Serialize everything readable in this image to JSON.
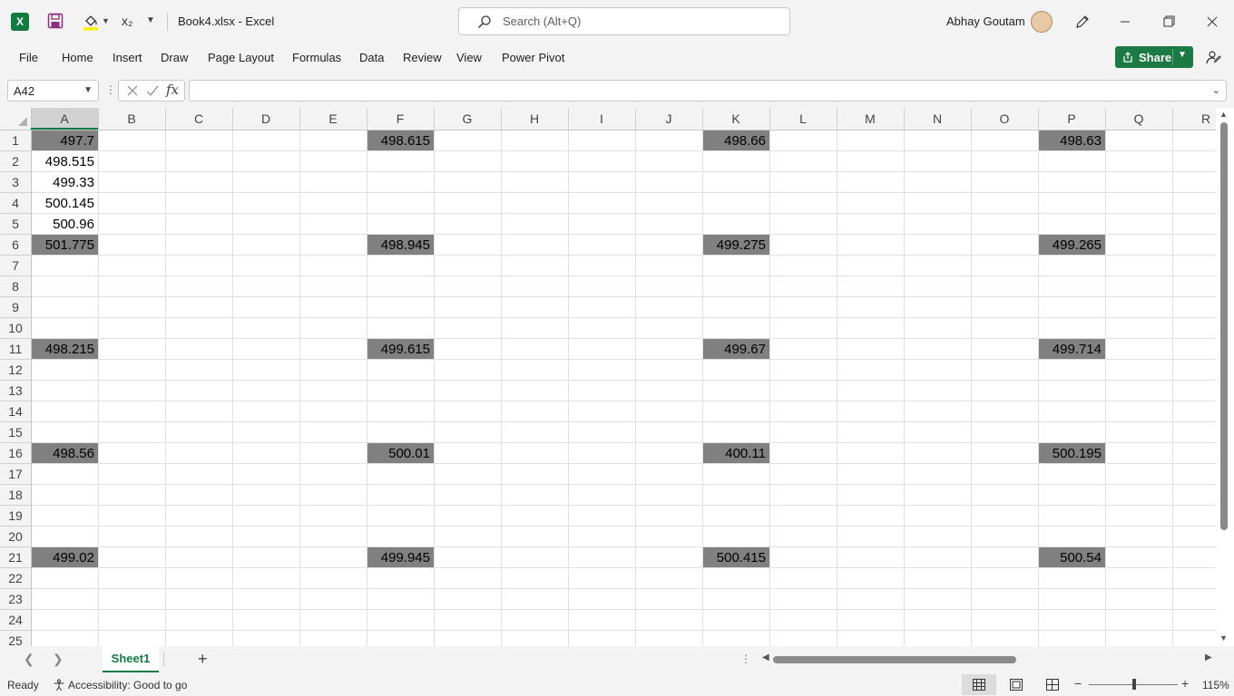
{
  "titlebar": {
    "doc_title": "Book4.xlsx  -  Excel",
    "search_placeholder": "Search (Alt+Q)",
    "user_name": "Abhay Goutam",
    "subscript_label": "x₂",
    "logo_letter": "X"
  },
  "ribbon": {
    "tabs": [
      "File",
      "Home",
      "Insert",
      "Draw",
      "Page Layout",
      "Formulas",
      "Data",
      "Review",
      "View",
      "Power Pivot"
    ],
    "share_label": "Share"
  },
  "formula_bar": {
    "name_box": "A42",
    "fx_label": "fx",
    "formula": ""
  },
  "grid": {
    "columns": [
      "A",
      "B",
      "C",
      "D",
      "E",
      "F",
      "G",
      "H",
      "I",
      "J",
      "K",
      "L",
      "M",
      "N",
      "O",
      "P",
      "Q",
      "R"
    ],
    "rows": [
      "1",
      "2",
      "3",
      "4",
      "5",
      "6",
      "7",
      "8",
      "9",
      "10",
      "11",
      "12",
      "13",
      "14",
      "15",
      "16",
      "17",
      "18",
      "19",
      "20",
      "21",
      "22",
      "23",
      "24",
      "25"
    ],
    "active_column": "A",
    "highlight_fill": "#808080",
    "cells": [
      {
        "col": "A",
        "row": 1,
        "value": "497.7",
        "highlight": true
      },
      {
        "col": "A",
        "row": 2,
        "value": "498.515",
        "highlight": false
      },
      {
        "col": "A",
        "row": 3,
        "value": "499.33",
        "highlight": false
      },
      {
        "col": "A",
        "row": 4,
        "value": "500.145",
        "highlight": false
      },
      {
        "col": "A",
        "row": 5,
        "value": "500.96",
        "highlight": false
      },
      {
        "col": "A",
        "row": 6,
        "value": "501.775",
        "highlight": true
      },
      {
        "col": "A",
        "row": 11,
        "value": "498.215",
        "highlight": true
      },
      {
        "col": "A",
        "row": 16,
        "value": "498.56",
        "highlight": true
      },
      {
        "col": "A",
        "row": 21,
        "value": "499.02",
        "highlight": true
      },
      {
        "col": "F",
        "row": 1,
        "value": "498.615",
        "highlight": true
      },
      {
        "col": "F",
        "row": 6,
        "value": "498.945",
        "highlight": true
      },
      {
        "col": "F",
        "row": 11,
        "value": "499.615",
        "highlight": true
      },
      {
        "col": "F",
        "row": 16,
        "value": "500.01",
        "highlight": true
      },
      {
        "col": "F",
        "row": 21,
        "value": "499.945",
        "highlight": true
      },
      {
        "col": "K",
        "row": 1,
        "value": "498.66",
        "highlight": true
      },
      {
        "col": "K",
        "row": 6,
        "value": "499.275",
        "highlight": true
      },
      {
        "col": "K",
        "row": 11,
        "value": "499.67",
        "highlight": true
      },
      {
        "col": "K",
        "row": 16,
        "value": "400.11",
        "highlight": true
      },
      {
        "col": "K",
        "row": 21,
        "value": "500.415",
        "highlight": true
      },
      {
        "col": "P",
        "row": 1,
        "value": "498.63",
        "highlight": true
      },
      {
        "col": "P",
        "row": 6,
        "value": "499.265",
        "highlight": true
      },
      {
        "col": "P",
        "row": 11,
        "value": "499.714",
        "highlight": true
      },
      {
        "col": "P",
        "row": 16,
        "value": "500.195",
        "highlight": true
      },
      {
        "col": "P",
        "row": 21,
        "value": "500.54",
        "highlight": true
      }
    ]
  },
  "sheets": {
    "active": "Sheet1",
    "add_label": "+"
  },
  "statusbar": {
    "ready": "Ready",
    "accessibility": "Accessibility: Good to go",
    "zoom": "115%"
  },
  "colors": {
    "accent": "#107c41",
    "share": "#1b7a43",
    "highlight": "#808080"
  }
}
